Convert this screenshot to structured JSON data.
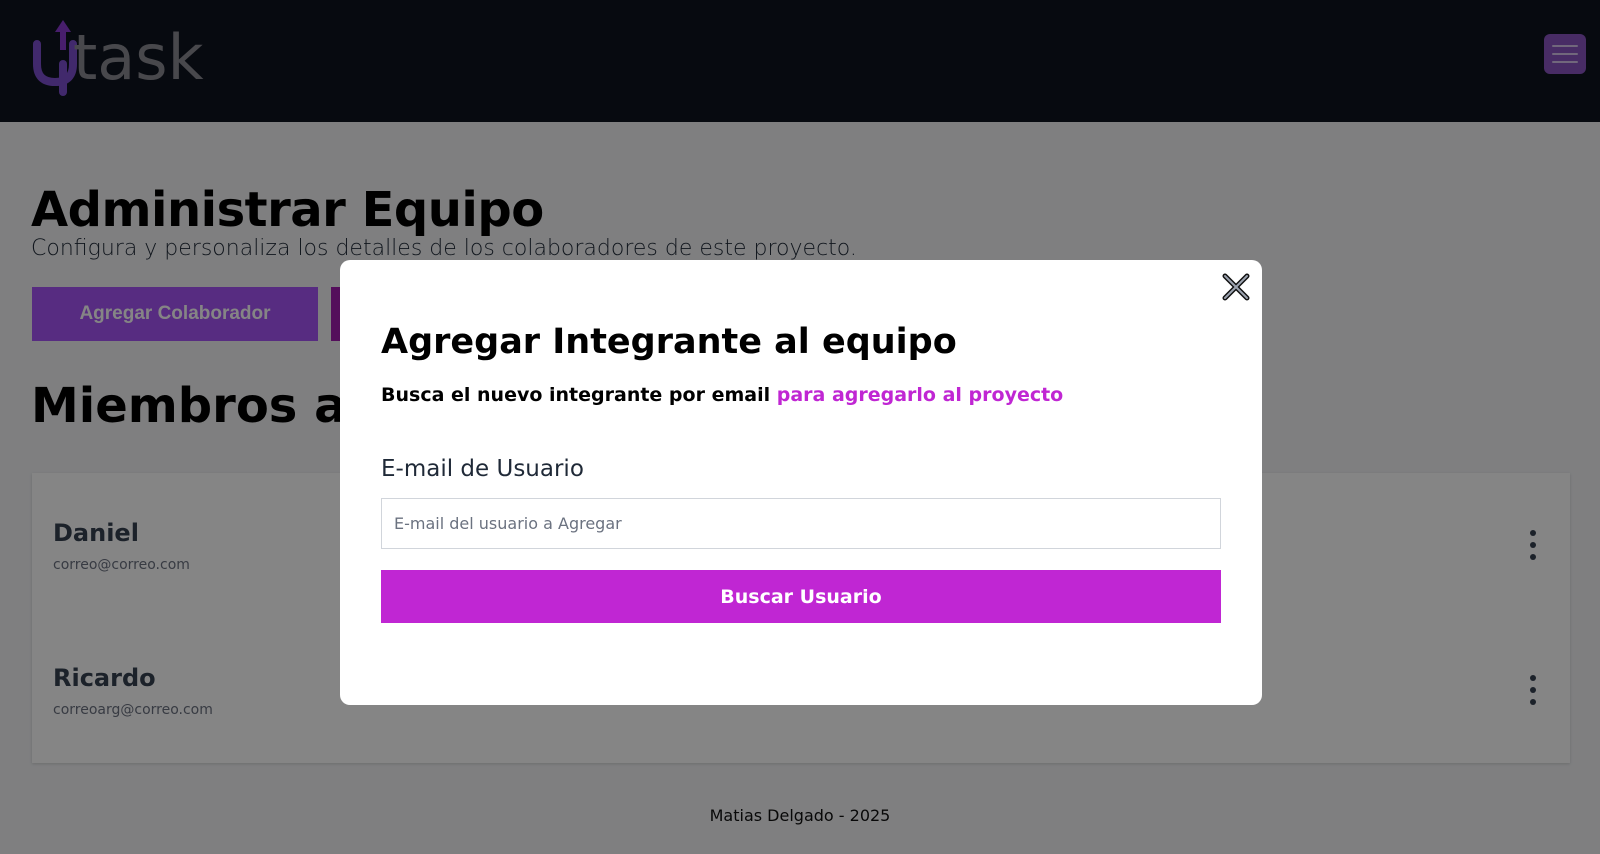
{
  "header": {
    "logo_text": "task",
    "colors": {
      "background": "#0f1420",
      "brand_purple": "#8a55c2"
    }
  },
  "main": {
    "title": "Administrar Equipo",
    "subtitle": "Configura y personaliza los detalles de los colaboradores de este proyecto.",
    "add_button_label": "Agregar Colaborador",
    "members_title": "Miembros actuales",
    "members": [
      {
        "name": "Daniel",
        "email": "correo@correo.com"
      },
      {
        "name": "Ricardo",
        "email": "correoarg@correo.com"
      }
    ]
  },
  "footer": {
    "text": "Matias Delgado - 2025"
  },
  "modal": {
    "title": "Agregar Integrante al equipo",
    "subtitle_plain": "Busca el nuevo integrante por email ",
    "subtitle_accent": "para agregarlo al proyecto",
    "field_label": "E-mail de Usuario",
    "email_placeholder": "E-mail del usuario a Agregar",
    "email_value": "",
    "search_button_label": "Buscar Usuario",
    "accent_color": "#c026d3"
  },
  "icons": {
    "close": "close-icon",
    "menu": "hamburger-icon",
    "member_options": "vertical-dots-icon",
    "logo_arrow": "up-arrow-icon"
  }
}
